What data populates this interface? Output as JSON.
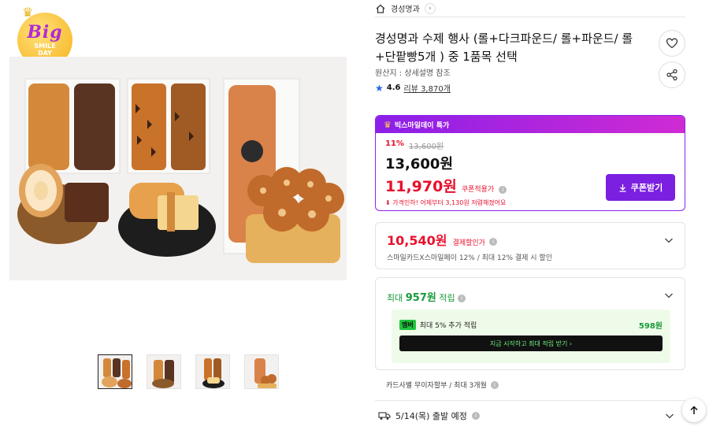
{
  "badge": {
    "big": "Big",
    "line1": "SMILE",
    "line2": "DAY"
  },
  "breadcrumb": {
    "store": "경성명과",
    "chevron": "›"
  },
  "product": {
    "title": "경성명과 수제 행사 (롤+다크파운드/ 롤+파운드/ 롤+단팥빵5개 ) 중 1품목 선택",
    "origin": "원산지 : 상세설명 참조",
    "rating": "4.6",
    "reviews": "리뷰 3,870개"
  },
  "promo": {
    "label": "빅스마일데이 특가",
    "discount_rate": "11%",
    "original_price": "13,600원",
    "sale_price": "13,600원",
    "coupon_price": "11,970원",
    "coupon_label": "쿠폰적용가",
    "price_note": "가격인하! 어제부터 3,130원 저렴해졌어요",
    "coupon_button": "쿠폰받기"
  },
  "card_discount": {
    "price": "10,540원",
    "tag": "결제할인가",
    "description": "스마일카드X스마일페이 12% / 최대 12% 결제 시 할인"
  },
  "points": {
    "prefix": "최대",
    "amount": "957원",
    "suffix": "적립",
    "member_badge": "멤버",
    "member_text": "최대 5% 추가 적립",
    "member_amount": "598원",
    "member_cta": "지금 시작하고 최대 적립 받기 ›"
  },
  "installment": "카드사별 무이자할부 / 최대 3개월",
  "shipping": "5/14(목) 출발 예정",
  "icons": {
    "home": "home-icon",
    "heart": "heart-icon",
    "share": "share-icon",
    "star": "star-icon",
    "download": "download-icon",
    "chevron": "chevron-down-icon",
    "truck": "truck-icon",
    "arrow_up": "arrow-up-icon",
    "info": "info-icon"
  },
  "colors": {
    "accent_purple": "#7b1fe0",
    "price_red": "#e8112d",
    "points_green": "#1a9a3a"
  }
}
